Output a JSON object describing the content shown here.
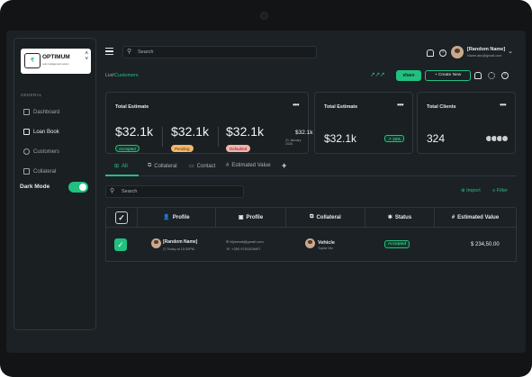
{
  "brand": {
    "name": "OPTIMUM",
    "tagline": "Loan management system",
    "badge": "₹"
  },
  "sidebar": {
    "section": "GENERAL",
    "items": [
      {
        "label": "Dashboard"
      },
      {
        "label": "Loan Book"
      },
      {
        "label": "Customers"
      },
      {
        "label": "Collateral"
      }
    ],
    "dark_mode_label": "Dark Mode",
    "dark_mode_on": true
  },
  "topbar": {
    "search_placeholder": "Search",
    "user_name": "[Random Name]",
    "user_email": "Name.abc@gmail.com"
  },
  "breadcrumb": {
    "prefix": "List/",
    "current": "Customers"
  },
  "actions": {
    "ext_icons": "↗↗↗",
    "small_button": "share",
    "create_button": "+ Create New"
  },
  "cards": {
    "estimate": {
      "title": "Total Estimate",
      "stats": [
        {
          "amount": "$32.1k",
          "badge": "Accepted"
        },
        {
          "amount": "$32.1k",
          "badge": "Pending"
        },
        {
          "amount": "$32.1k",
          "badge": "Defaulted"
        }
      ],
      "side_amount": "$32.1k",
      "side_date": "21 January 2026"
    },
    "estimate2": {
      "title": "Total Estimate",
      "value": "$32.1k",
      "badge": "↗ 15%"
    },
    "clients": {
      "title": "Total Clients",
      "value": "324"
    }
  },
  "tabs": [
    {
      "label": "All"
    },
    {
      "label": "Collateral"
    },
    {
      "label": "Contact"
    },
    {
      "label": "Estimated Value"
    }
  ],
  "table": {
    "search_placeholder": "Search",
    "import_label": "Import",
    "filter_label": "Filter",
    "columns": [
      "Profile",
      "Profile",
      "Collateral",
      "Status",
      "Estimated Value"
    ],
    "rows": [
      {
        "name": "[Random Name]",
        "date": "Today at 10:30PM",
        "email": "Myemail@gmail.com",
        "phone": "+260 9701209497",
        "collateral": "Vehicle",
        "collateral_sub": "Toyota Vitz",
        "status": "Accepted",
        "value": "$   234,50.00"
      }
    ]
  },
  "colors": {
    "accent": "#21c07f",
    "background": "#1c2125",
    "panel": "#1a1f22",
    "border": "#2e363c"
  }
}
